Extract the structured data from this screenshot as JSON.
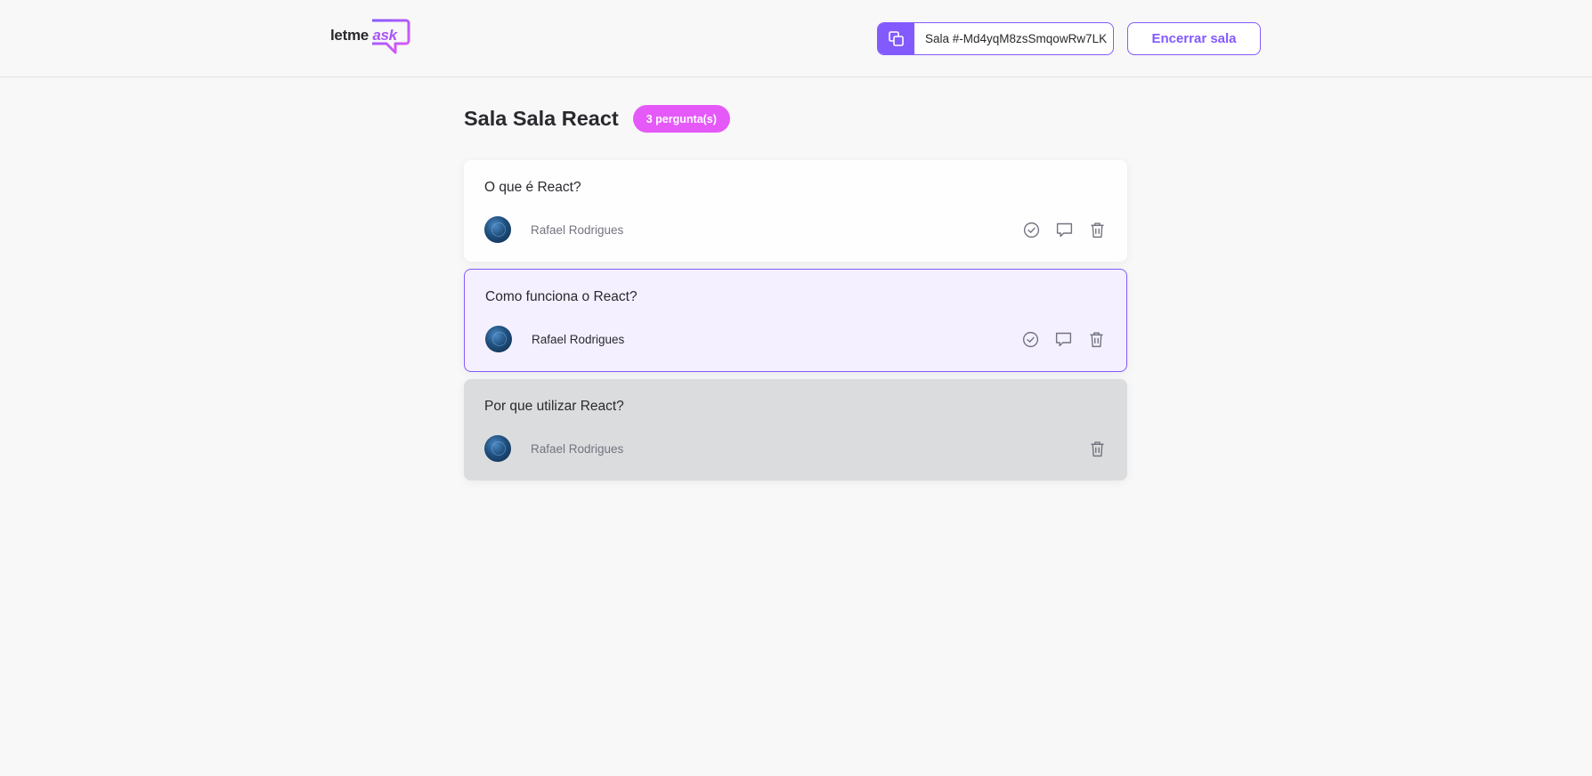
{
  "header": {
    "logo_text": "letme",
    "logo_accent": "ask",
    "room_code": "Sala #-Md4yqM8zsSmqowRw7LK",
    "end_button": "Encerrar sala"
  },
  "page": {
    "title": "Sala Sala React",
    "question_count": "3 pergunta(s)"
  },
  "questions": [
    {
      "content": "O que é React?",
      "author": "Rafael Rodrigues",
      "state": "normal"
    },
    {
      "content": "Como funciona o React?",
      "author": "Rafael Rodrigues",
      "state": "highlighted"
    },
    {
      "content": "Por que utilizar React?",
      "author": "Rafael Rodrigues",
      "state": "answered"
    }
  ],
  "icons": {
    "copy": "copy-icon",
    "check": "check-circle-icon",
    "answer": "chat-bubble-icon",
    "delete": "trash-icon"
  },
  "colors": {
    "accent": "#835afd",
    "badge": "#e559f9",
    "highlight_bg": "#f4f0ff",
    "answered_bg": "#dbdcdd"
  }
}
